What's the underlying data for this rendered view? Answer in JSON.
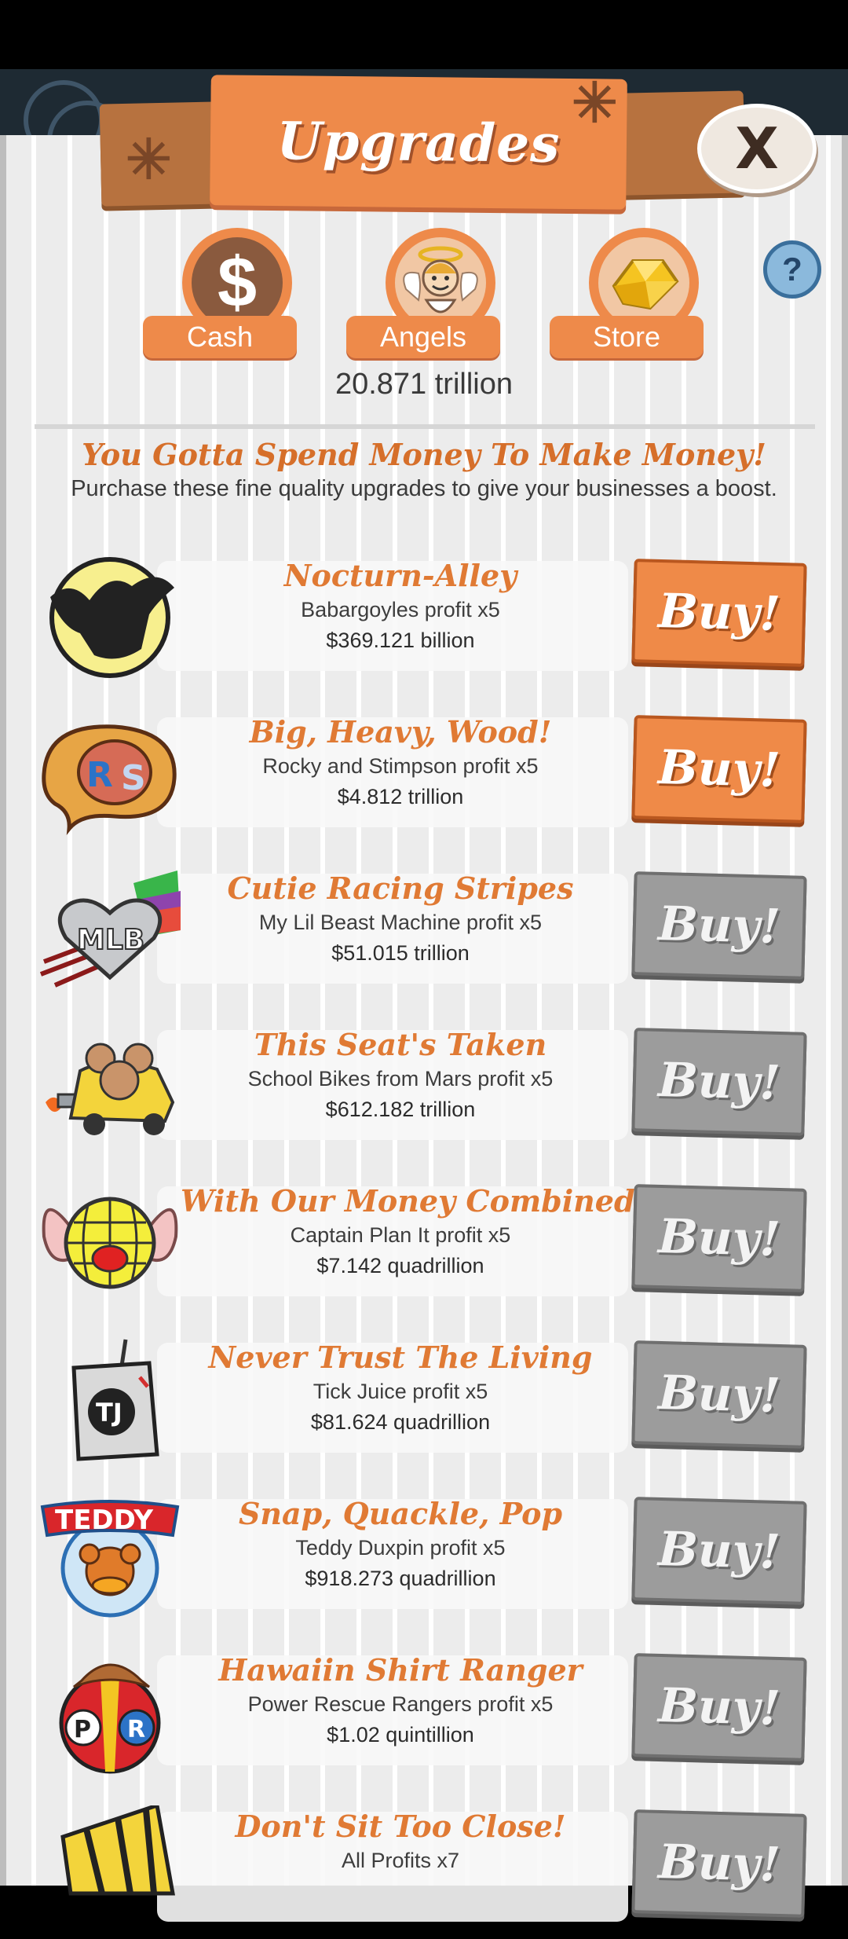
{
  "header": {
    "title": "Upgrades",
    "close_label": "X",
    "help_label": "?"
  },
  "tabs": [
    {
      "label": "Cash",
      "icon": "dollar-icon"
    },
    {
      "label": "Angels",
      "icon": "angel-icon"
    },
    {
      "label": "Store",
      "icon": "gold-gem-icon"
    }
  ],
  "balance": "20.871 trillion",
  "intro": {
    "headline": "You Gotta Spend Money To Make Money!",
    "subline": "Purchase these fine quality upgrades to give your businesses a boost."
  },
  "buy_label": "Buy!",
  "upgrades": [
    {
      "title": "Nocturn-Alley",
      "desc": "Babargoyles profit x5",
      "price": "$369.121 billion",
      "state": "active",
      "icon": "gargoyle-moon-icon"
    },
    {
      "title": "Big, Heavy, Wood!",
      "desc": "Rocky and Stimpson profit x5",
      "price": "$4.812 trillion",
      "state": "active",
      "icon": "rocky-stimpson-logo-icon"
    },
    {
      "title": "Cutie Racing Stripes",
      "desc": "My Lil Beast Machine profit x5",
      "price": "$51.015 trillion",
      "state": "disabled",
      "icon": "mlb-heart-icon"
    },
    {
      "title": "This Seat's Taken",
      "desc": "School Bikes from Mars profit x5",
      "price": "$612.182 trillion",
      "state": "disabled",
      "icon": "mouse-car-icon"
    },
    {
      "title": "With Our Money Combined...",
      "desc": "Captain Plan It profit x5",
      "price": "$7.142 quadrillion",
      "state": "disabled",
      "icon": "globe-ears-icon"
    },
    {
      "title": "Never Trust The Living",
      "desc": "Tick Juice profit x5",
      "price": "$81.624 quadrillion",
      "state": "disabled",
      "icon": "juice-box-icon"
    },
    {
      "title": "Snap, Quackle, Pop",
      "desc": "Teddy Duxpin profit x5",
      "price": "$918.273 quadrillion",
      "state": "disabled",
      "icon": "teddy-duck-icon"
    },
    {
      "title": "Hawaiin Shirt Ranger",
      "desc": "Power Rescue Rangers profit x5",
      "price": "$1.02 quintillion",
      "state": "disabled",
      "icon": "rescue-rangers-icon"
    },
    {
      "title": "Don't Sit Too Close!",
      "desc": "All Profits x7",
      "price": "",
      "state": "disabled",
      "icon": "striped-hat-icon"
    }
  ],
  "colors": {
    "accent_orange": "#ee8a4a",
    "title_orange": "#e07a34",
    "disabled_gray": "#9c9c9c"
  }
}
